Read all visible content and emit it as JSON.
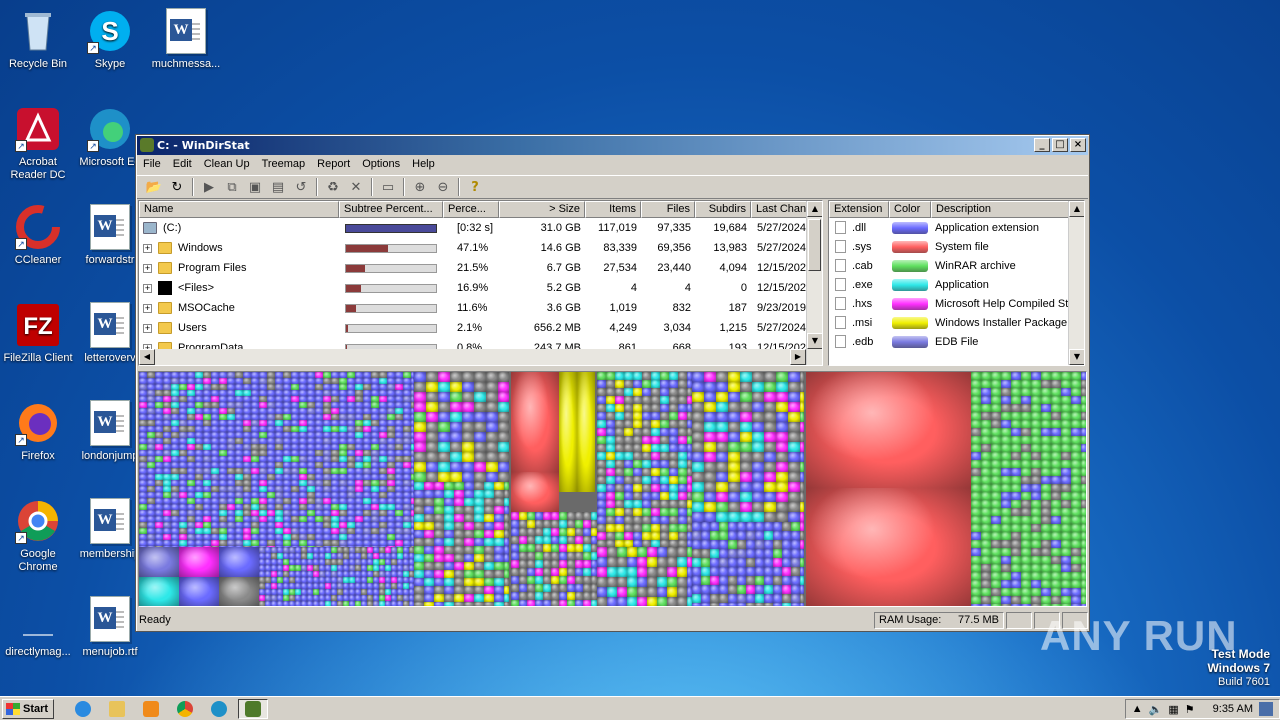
{
  "desktop": {
    "icons": [
      {
        "label": "Recycle Bin",
        "icon": "recycle-bin-icon"
      },
      {
        "label": "Skype",
        "icon": "skype-icon"
      },
      {
        "label": "muchmessa...",
        "icon": "word-document-icon"
      },
      {
        "label": "Acrobat Reader DC",
        "icon": "acrobat-icon"
      },
      {
        "label": "Microsoft Ed",
        "icon": "edge-icon"
      },
      {
        "label": "CCleaner",
        "icon": "ccleaner-icon"
      },
      {
        "label": "forwardstr",
        "icon": "word-document-icon"
      },
      {
        "label": "FileZilla Client",
        "icon": "filezilla-icon"
      },
      {
        "label": "letteroverv",
        "icon": "word-document-icon"
      },
      {
        "label": "Firefox",
        "icon": "firefox-icon"
      },
      {
        "label": "londonjump",
        "icon": "word-document-icon"
      },
      {
        "label": "Google Chrome",
        "icon": "chrome-icon"
      },
      {
        "label": "membership",
        "icon": "word-document-icon"
      },
      {
        "label": "directlymag...",
        "icon": "blank-document-icon"
      },
      {
        "label": "menujob.rtf",
        "icon": "word-document-icon"
      }
    ]
  },
  "window": {
    "title": "C: - WinDirStat",
    "menu": [
      "File",
      "Edit",
      "Clean Up",
      "Treemap",
      "Report",
      "Options",
      "Help"
    ]
  },
  "dirlist": {
    "headers": [
      "Name",
      "Subtree Percent...",
      "Perce...",
      "> Size",
      "Items",
      "Files",
      "Subdirs",
      "Last Chan"
    ],
    "rows": [
      {
        "name": "(C:)",
        "pct": "[0:32 s]",
        "bar": 1.0,
        "size": "31.0 GB",
        "items": "117,019",
        "files": "97,335",
        "subdirs": "19,684",
        "date": "5/27/2024",
        "kind": "drive"
      },
      {
        "name": "Windows",
        "pct": "47.1%",
        "bar": 0.471,
        "size": "14.6 GB",
        "items": "83,339",
        "files": "69,356",
        "subdirs": "13,983",
        "date": "5/27/2024",
        "kind": "folder"
      },
      {
        "name": "Program Files",
        "pct": "21.5%",
        "bar": 0.215,
        "size": "6.7 GB",
        "items": "27,534",
        "files": "23,440",
        "subdirs": "4,094",
        "date": "12/15/202",
        "kind": "folder"
      },
      {
        "name": "<Files>",
        "pct": "16.9%",
        "bar": 0.169,
        "size": "5.2 GB",
        "items": "4",
        "files": "4",
        "subdirs": "0",
        "date": "12/15/202",
        "kind": "files"
      },
      {
        "name": "MSOCache",
        "pct": "11.6%",
        "bar": 0.116,
        "size": "3.6 GB",
        "items": "1,019",
        "files": "832",
        "subdirs": "187",
        "date": "9/23/2019",
        "kind": "folder"
      },
      {
        "name": "Users",
        "pct": "2.1%",
        "bar": 0.021,
        "size": "656.2 MB",
        "items": "4,249",
        "files": "3,034",
        "subdirs": "1,215",
        "date": "5/27/2024",
        "kind": "folder"
      },
      {
        "name": "ProgramData",
        "pct": "0.8%",
        "bar": 0.008,
        "size": "243.7 MB",
        "items": "861",
        "files": "668",
        "subdirs": "193",
        "date": "12/15/202",
        "kind": "folder"
      }
    ]
  },
  "extlist": {
    "headers": [
      "Extension",
      "Color",
      "Description"
    ],
    "rows": [
      {
        "ext": ".dll",
        "color": "#6b6bff",
        "desc": "Application extension"
      },
      {
        "ext": ".sys",
        "color": "#ff5f5f",
        "desc": "System file"
      },
      {
        "ext": ".cab",
        "color": "#5fe05f",
        "desc": "WinRAR archive"
      },
      {
        "ext": ".exe",
        "color": "#2ee8e8",
        "desc": "Application"
      },
      {
        "ext": ".hxs",
        "color": "#ff2fff",
        "desc": "Microsoft Help Compiled Stor"
      },
      {
        "ext": ".msi",
        "color": "#f0f000",
        "desc": "Windows Installer Package"
      },
      {
        "ext": ".edb",
        "color": "#7a7ae0",
        "desc": "EDB File"
      }
    ]
  },
  "status": {
    "text": "Ready",
    "ram_label": "RAM Usage:",
    "ram_value": "77.5 MB"
  },
  "taskbar": {
    "start": "Start",
    "clock": "9:35 AM"
  },
  "watermark": {
    "line1": "Test Mode",
    "line2": "Windows 7",
    "line3": "Build 7601",
    "brand": "ANY RUN"
  }
}
